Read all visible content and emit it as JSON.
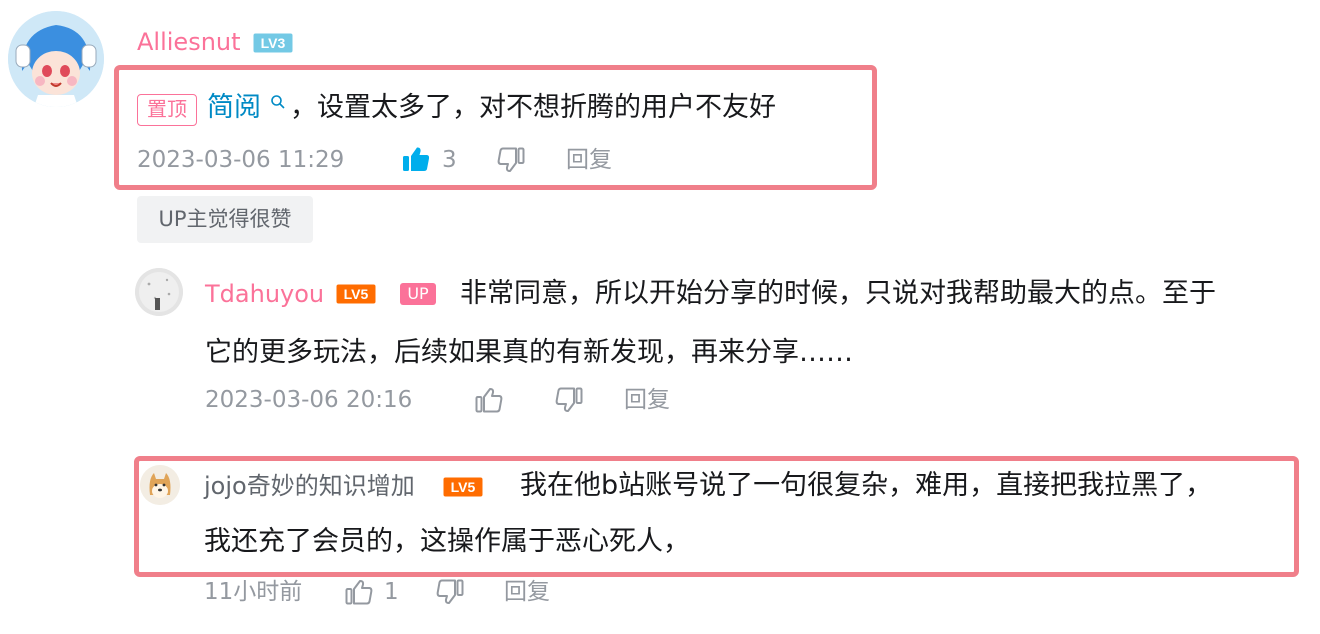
{
  "comment": {
    "user": "Alliesnut",
    "level": "LV3",
    "pinned_tag": "置顶",
    "link_text": "简阅",
    "text": "，设置太多了，对不想折腾的用户不友好",
    "timestamp": "2023-03-06 11:29",
    "like_count": "3",
    "reply_label": "回复",
    "up_liked_badge": "UP主觉得很赞"
  },
  "replies": [
    {
      "user": "Tdahuyou",
      "level": "LV5",
      "up_tag": "UP",
      "text_line1": "非常同意，所以开始分享的时候，只说对我帮助最大的点。至于",
      "text_line2": "它的更多玩法，后续如果真的有新发现，再来分享……",
      "timestamp": "2023-03-06 20:16",
      "reply_label": "回复"
    },
    {
      "user": "jojo奇妙的知识增加",
      "level": "LV5",
      "text_line1": "我在他b站账号说了一句很复杂，难用，直接把我拉黑了，",
      "text_line2": "我还充了会员的，这操作属于恶心死人，",
      "timestamp": "11小时前",
      "like_count": "1",
      "reply_label": "回复"
    }
  ],
  "colors": {
    "username_pink": "#fb7299",
    "link_blue": "#008ac5",
    "like_active": "#00aeec",
    "highlight_border": "#f07f8a",
    "lv3_badge": "#73c9e5",
    "lv5_badge": "#ff6c00"
  }
}
